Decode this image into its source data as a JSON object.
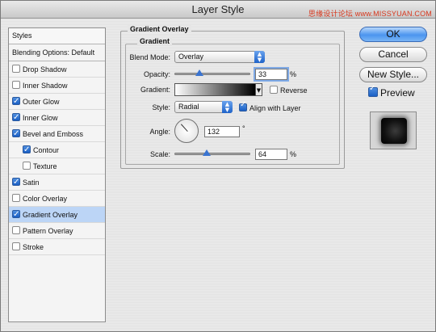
{
  "window": {
    "title": "Layer Style",
    "watermark": "思缘设计论坛 www.MISSYUAN.COM"
  },
  "styles_list": {
    "header": "Styles",
    "blending_options": "Blending Options: Default",
    "items": [
      {
        "label": "Drop Shadow",
        "checked": false,
        "indent": false,
        "selected": false
      },
      {
        "label": "Inner Shadow",
        "checked": false,
        "indent": false,
        "selected": false
      },
      {
        "label": "Outer Glow",
        "checked": true,
        "indent": false,
        "selected": false
      },
      {
        "label": "Inner Glow",
        "checked": true,
        "indent": false,
        "selected": false
      },
      {
        "label": "Bevel and Emboss",
        "checked": true,
        "indent": false,
        "selected": false
      },
      {
        "label": "Contour",
        "checked": true,
        "indent": true,
        "selected": false
      },
      {
        "label": "Texture",
        "checked": false,
        "indent": true,
        "selected": false
      },
      {
        "label": "Satin",
        "checked": true,
        "indent": false,
        "selected": false
      },
      {
        "label": "Color Overlay",
        "checked": false,
        "indent": false,
        "selected": false
      },
      {
        "label": "Gradient Overlay",
        "checked": true,
        "indent": false,
        "selected": true
      },
      {
        "label": "Pattern Overlay",
        "checked": false,
        "indent": false,
        "selected": false
      },
      {
        "label": "Stroke",
        "checked": false,
        "indent": false,
        "selected": false
      }
    ]
  },
  "gradient_overlay": {
    "group_title": "Gradient Overlay",
    "subgroup_title": "Gradient",
    "blend_mode": {
      "label": "Blend Mode:",
      "value": "Overlay"
    },
    "opacity": {
      "label": "Opacity:",
      "value": "33",
      "unit": "%",
      "level": 0.33
    },
    "gradient": {
      "label": "Gradient:",
      "from_color": "#ffffff",
      "to_color": "#000000"
    },
    "reverse": {
      "label": "Reverse",
      "checked": false
    },
    "style": {
      "label": "Style:",
      "value": "Radial"
    },
    "align_with_layer": {
      "label": "Align with Layer",
      "checked": true
    },
    "angle": {
      "label": "Angle:",
      "value": "132",
      "unit": "°"
    },
    "scale": {
      "label": "Scale:",
      "value": "64",
      "unit": "%",
      "level": 0.43
    }
  },
  "buttons": {
    "ok": "OK",
    "cancel": "Cancel",
    "new_style": "New Style..."
  },
  "preview": {
    "label": "Preview",
    "checked": true
  },
  "colors": {
    "accent": "#3a74d1",
    "selection": "#bcd5f6"
  }
}
